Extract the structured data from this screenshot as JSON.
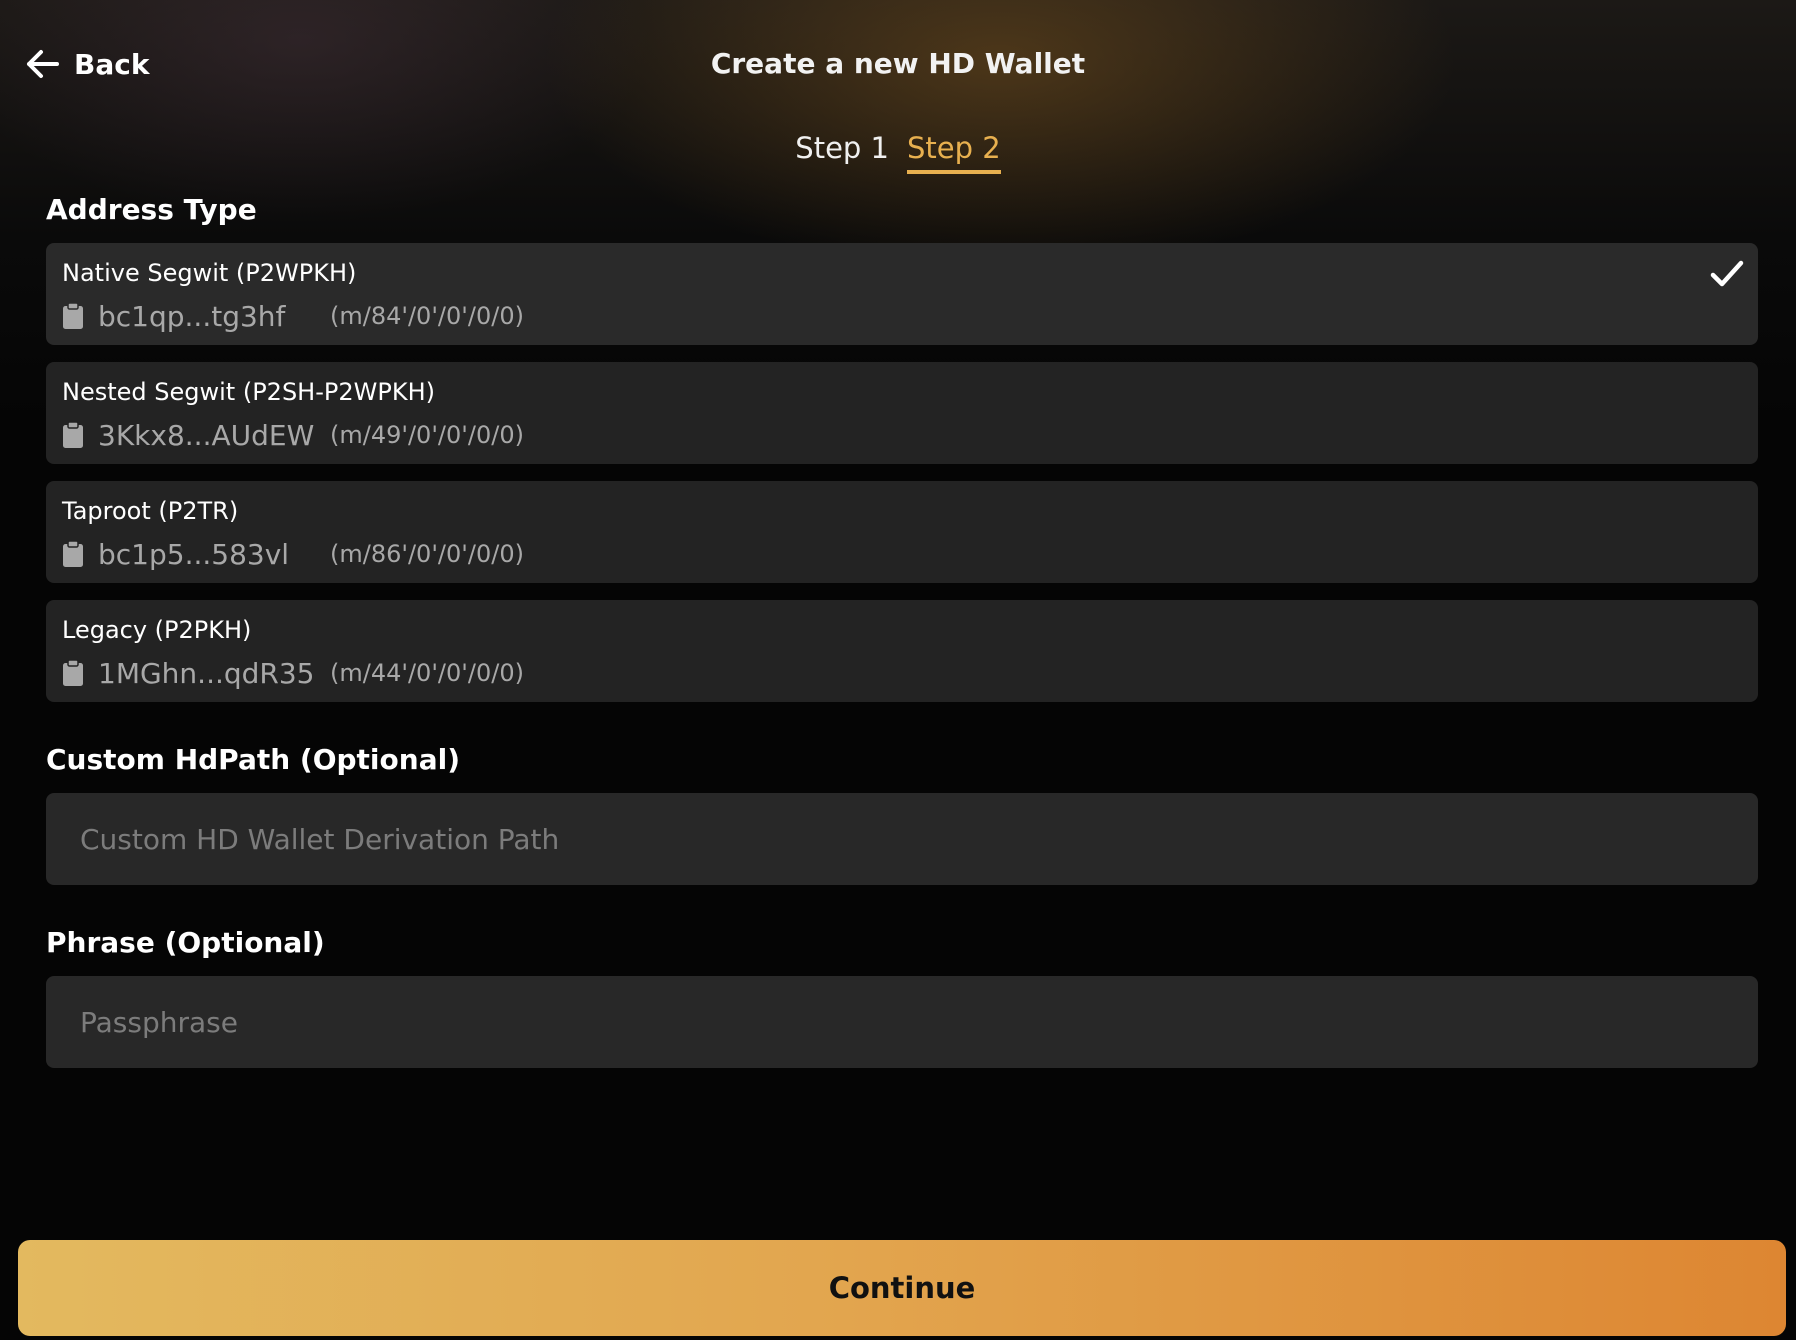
{
  "header": {
    "back_label": "Back",
    "title": "Create a new HD Wallet"
  },
  "steps": [
    {
      "label": "Step 1",
      "active": false
    },
    {
      "label": "Step 2",
      "active": true
    }
  ],
  "address_type": {
    "label": "Address Type",
    "options": [
      {
        "name": "Native Segwit (P2WPKH)",
        "address": "bc1qp...tg3hf",
        "path": "(m/84'/0'/0'/0/0)",
        "selected": true
      },
      {
        "name": "Nested Segwit (P2SH-P2WPKH)",
        "address": "3Kkx8...AUdEW",
        "path": "(m/49'/0'/0'/0/0)",
        "selected": false
      },
      {
        "name": "Taproot (P2TR)",
        "address": "bc1p5...583vl",
        "path": "(m/86'/0'/0'/0/0)",
        "selected": false
      },
      {
        "name": "Legacy (P2PKH)",
        "address": "1MGhn...qdR35",
        "path": "(m/44'/0'/0'/0/0)",
        "selected": false
      }
    ]
  },
  "custom_hdpath": {
    "label": "Custom HdPath (Optional)",
    "value": "",
    "placeholder": "Custom HD Wallet Derivation Path"
  },
  "phrase": {
    "label": "Phrase (Optional)",
    "value": "",
    "placeholder": "Passphrase"
  },
  "continue_label": "Continue",
  "colors": {
    "accent": "#e8b04f",
    "button_gradient_start": "#e3b95f",
    "button_gradient_end": "#dd8632",
    "card_background": "#232323"
  },
  "icons": {
    "back": "arrow-left-icon",
    "copy": "clipboard-icon",
    "selected": "checkmark-icon"
  }
}
